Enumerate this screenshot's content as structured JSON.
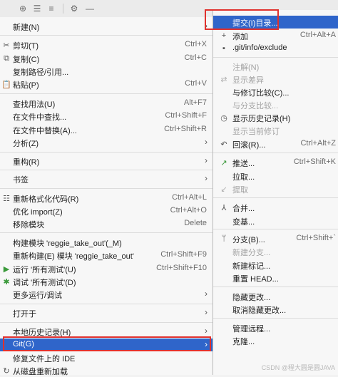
{
  "toolbar": {
    "icons": [
      "crosshair-icon",
      "expand-all-icon",
      "collapse-all-icon",
      "gear-icon",
      "minimize-icon"
    ]
  },
  "left_menu": {
    "items": [
      {
        "label": "新建(N)",
        "shortcut": "",
        "icon": "",
        "has_submenu": true
      },
      {
        "label": "剪切(T)",
        "shortcut": "Ctrl+X",
        "icon": "scissors-icon",
        "has_submenu": false
      },
      {
        "label": "复制(C)",
        "shortcut": "Ctrl+C",
        "icon": "copy-icon",
        "has_submenu": false
      },
      {
        "label": "复制路径/引用...",
        "shortcut": "",
        "icon": "",
        "has_submenu": false
      },
      {
        "label": "粘贴(P)",
        "shortcut": "Ctrl+V",
        "icon": "paste-icon",
        "has_submenu": false
      },
      {
        "label": "查找用法(U)",
        "shortcut": "Alt+F7",
        "icon": "",
        "has_submenu": false
      },
      {
        "label": "在文件中查找...",
        "shortcut": "Ctrl+Shift+F",
        "icon": "",
        "has_submenu": false
      },
      {
        "label": "在文件中替换(A)...",
        "shortcut": "Ctrl+Shift+R",
        "icon": "",
        "has_submenu": false
      },
      {
        "label": "分析(Z)",
        "shortcut": "",
        "icon": "",
        "has_submenu": true
      },
      {
        "label": "重构(R)",
        "shortcut": "",
        "icon": "",
        "has_submenu": true
      },
      {
        "label": "书签",
        "shortcut": "",
        "icon": "",
        "has_submenu": true
      },
      {
        "label": "重新格式化代码(R)",
        "shortcut": "Ctrl+Alt+L",
        "icon": "reformat-icon",
        "has_submenu": false
      },
      {
        "label": "优化 import(Z)",
        "shortcut": "Ctrl+Alt+O",
        "icon": "",
        "has_submenu": false
      },
      {
        "label": "移除模块",
        "shortcut": "Delete",
        "icon": "",
        "has_submenu": false
      },
      {
        "label": "构建模块 'reggie_take_out'(_M)",
        "shortcut": "",
        "icon": "",
        "has_submenu": false
      },
      {
        "label": "重新构建(E) 模块 'reggie_take_out'",
        "shortcut": "Ctrl+Shift+F9",
        "icon": "",
        "has_submenu": false
      },
      {
        "label": "运行 '所有测试'(U)",
        "shortcut": "Ctrl+Shift+F10",
        "icon": "run-icon",
        "has_submenu": false
      },
      {
        "label": "调试 '所有测试'(D)",
        "shortcut": "",
        "icon": "debug-icon",
        "has_submenu": false
      },
      {
        "label": "更多运行/调试",
        "shortcut": "",
        "icon": "",
        "has_submenu": true
      },
      {
        "label": "打开于",
        "shortcut": "",
        "icon": "",
        "has_submenu": true
      },
      {
        "label": "本地历史记录(H)",
        "shortcut": "",
        "icon": "",
        "has_submenu": true
      },
      {
        "label": "Git(G)",
        "shortcut": "",
        "icon": "",
        "has_submenu": true
      },
      {
        "label": "修复文件上的 IDE",
        "shortcut": "",
        "icon": "",
        "has_submenu": false
      },
      {
        "label": "从磁盘重新加载",
        "shortcut": "",
        "icon": "reload-icon",
        "has_submenu": false
      }
    ]
  },
  "git_menu": {
    "items": [
      {
        "label": "提交(I)目录...",
        "shortcut": "",
        "icon": "",
        "disabled": false
      },
      {
        "label": "添加",
        "shortcut": "Ctrl+Alt+A",
        "icon": "plus-icon",
        "disabled": false
      },
      {
        "label": ".git/info/exclude",
        "shortcut": "",
        "icon": "git-file-icon",
        "disabled": false
      },
      {
        "label": "注解(N)",
        "shortcut": "",
        "icon": "",
        "disabled": true
      },
      {
        "label": "显示差异",
        "shortcut": "",
        "icon": "diff-icon",
        "disabled": true
      },
      {
        "label": "与修订比较(C)...",
        "shortcut": "",
        "icon": "",
        "disabled": false
      },
      {
        "label": "与分支比较...",
        "shortcut": "",
        "icon": "",
        "disabled": true
      },
      {
        "label": "显示历史记录(H)",
        "shortcut": "",
        "icon": "history-icon",
        "disabled": false
      },
      {
        "label": "显示当前修订",
        "shortcut": "",
        "icon": "",
        "disabled": true
      },
      {
        "label": "回滚(R)...",
        "shortcut": "Ctrl+Alt+Z",
        "icon": "rollback-icon",
        "disabled": false
      },
      {
        "label": "推送...",
        "shortcut": "Ctrl+Shift+K",
        "icon": "push-icon",
        "disabled": false
      },
      {
        "label": "拉取...",
        "shortcut": "",
        "icon": "",
        "disabled": false
      },
      {
        "label": "提取",
        "shortcut": "",
        "icon": "fetch-icon",
        "disabled": true
      },
      {
        "label": "合并...",
        "shortcut": "",
        "icon": "merge-icon",
        "disabled": false
      },
      {
        "label": "变基...",
        "shortcut": "",
        "icon": "",
        "disabled": false
      },
      {
        "label": "分支(B)...",
        "shortcut": "Ctrl+Shift+`",
        "icon": "branch-icon",
        "disabled": false
      },
      {
        "label": "新建分支...",
        "shortcut": "",
        "icon": "",
        "disabled": true
      },
      {
        "label": "新建标记...",
        "shortcut": "",
        "icon": "",
        "disabled": false
      },
      {
        "label": "重置 HEAD...",
        "shortcut": "",
        "icon": "",
        "disabled": false
      },
      {
        "label": "隐藏更改...",
        "shortcut": "",
        "icon": "",
        "disabled": false
      },
      {
        "label": "取消隐藏更改...",
        "shortcut": "",
        "icon": "",
        "disabled": false
      },
      {
        "label": "管理远程...",
        "shortcut": "",
        "icon": "",
        "disabled": false
      },
      {
        "label": "克隆...",
        "shortcut": "",
        "icon": "",
        "disabled": false
      }
    ]
  },
  "watermark": "CSDN @程大圆是圆JAVA",
  "colors": {
    "selection": "#2f65ca",
    "highlight_box": "#e0312d",
    "disabled_text": "#a2a2a2"
  }
}
